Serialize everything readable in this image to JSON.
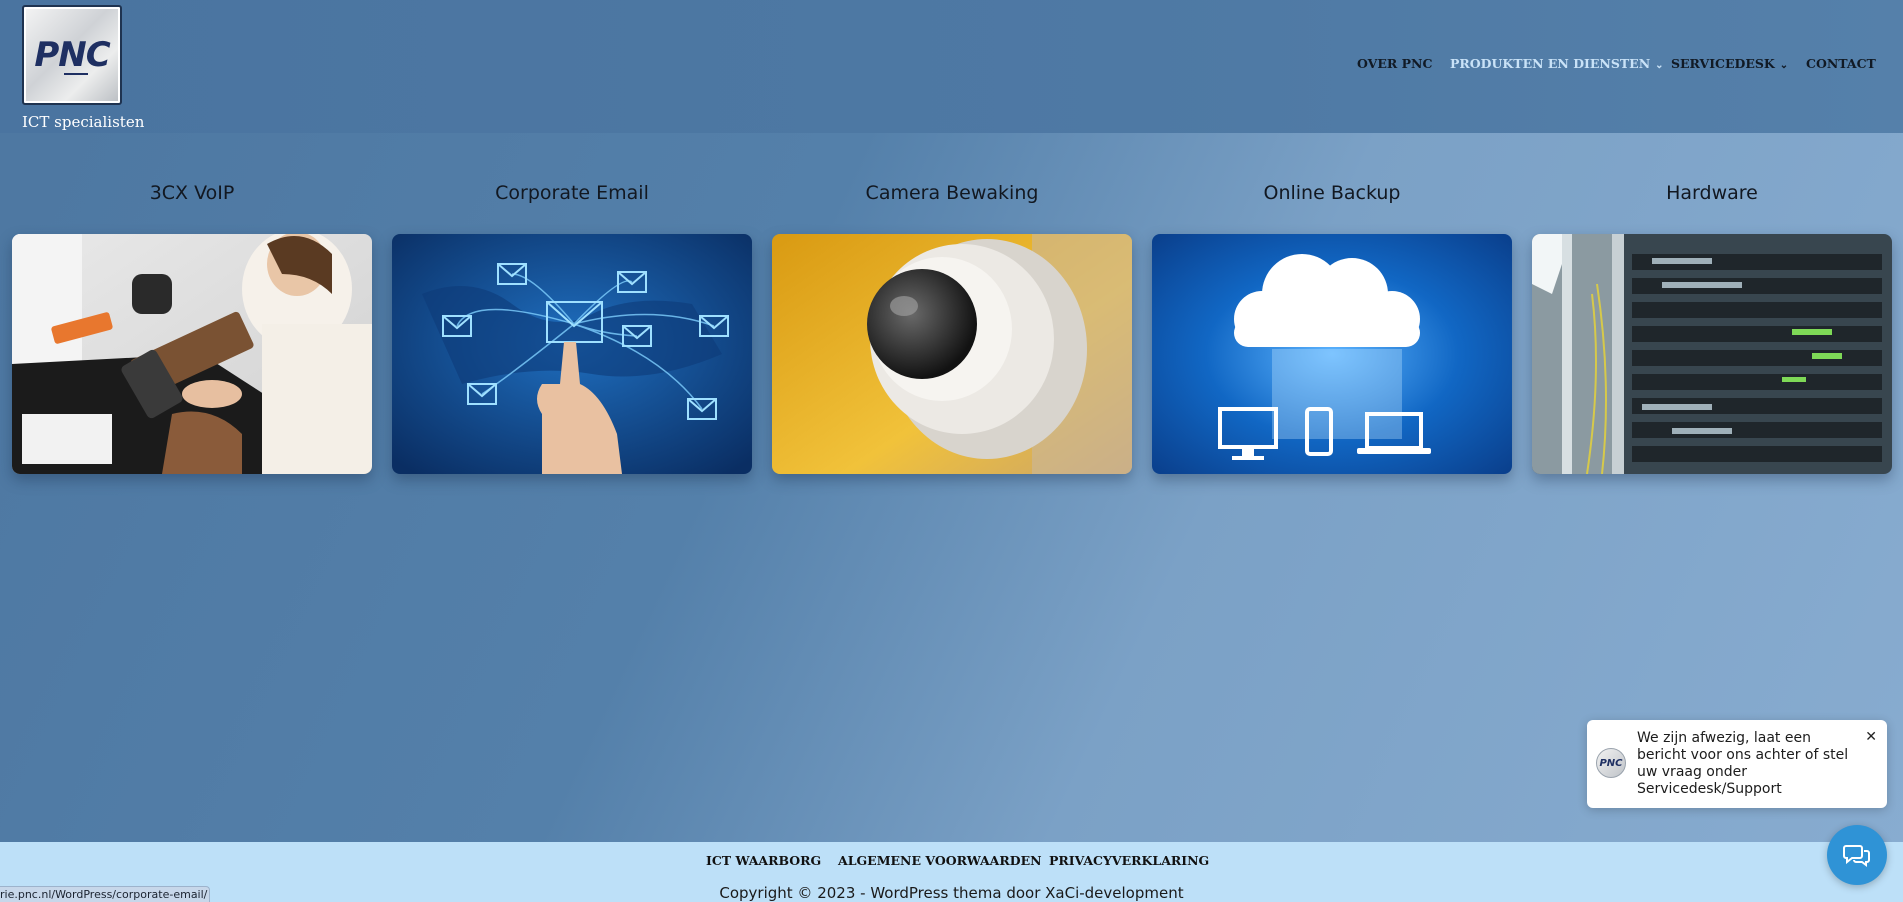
{
  "header": {
    "logo_text": "PNC",
    "tagline": "ICT specialisten",
    "nav": [
      {
        "label": "OVER PNC",
        "dropdown": false,
        "active": false
      },
      {
        "label": "PRODUKTEN EN DIENSTEN",
        "dropdown": true,
        "active": true
      },
      {
        "label": "SERVICEDESK",
        "dropdown": true,
        "active": false
      },
      {
        "label": "CONTACT",
        "dropdown": false,
        "active": false
      }
    ]
  },
  "cards": [
    {
      "title": "3CX VoIP",
      "image": "person-with-phone-at-desk"
    },
    {
      "title": "Corporate Email",
      "image": "email-network-world-map"
    },
    {
      "title": "Camera Bewaking",
      "image": "dome-security-camera"
    },
    {
      "title": "Online Backup",
      "image": "cloud-with-devices"
    },
    {
      "title": "Hardware",
      "image": "server-rack"
    }
  ],
  "footer": {
    "links": [
      "ICT WAARBORG",
      "ALGEMENE VOORWAARDEN",
      "PRIVACYVERKLARING"
    ],
    "copyright": "Copyright © 2023 - WordPress thema door XaCi-development"
  },
  "status_bar": {
    "url": "rie.pnc.nl/WordPress/corporate-email/"
  },
  "chat": {
    "avatar_text": "PNC",
    "message": "We zijn afwezig, laat een bericht voor ons achter of stel uw vraag onder Servicedesk/Support",
    "close_icon": "close-icon",
    "button_icon": "chat-bubbles-icon"
  },
  "colors": {
    "nav_active": "#c9e2f7",
    "footer_bg": "#bde0f8",
    "chat_button": "#2f93d6"
  }
}
